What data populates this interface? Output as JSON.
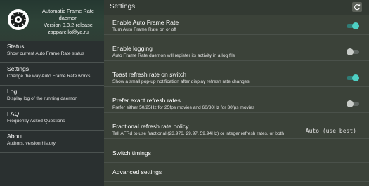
{
  "app": {
    "name_line1": "Automatic Frame Rate",
    "name_line2": "daemon",
    "version": "Version 0.3.2-release",
    "email": "zapparello@ya.ru"
  },
  "sidebar": {
    "items": [
      {
        "title": "Status",
        "desc": "Show current Auto Frame Rate status"
      },
      {
        "title": "Settings",
        "desc": "Change the way Auto Frame Rate works"
      },
      {
        "title": "Log",
        "desc": "Display log of the running daemon"
      },
      {
        "title": "FAQ",
        "desc": "Frequently Asked Questions"
      },
      {
        "title": "About",
        "desc": "Authors, version history"
      }
    ]
  },
  "header": {
    "title": "Settings",
    "refresh_icon": "refresh-icon"
  },
  "settings": {
    "enable_afr": {
      "title": "Enable Auto Frame Rate",
      "desc": "Turn Auto Frame Rate on or off",
      "on": true
    },
    "enable_logging": {
      "title": "Enable logging",
      "desc": "Auto Frame Rate daemon will register its activity in a log file",
      "on": false
    },
    "toast": {
      "title": "Toast refresh rate on switch",
      "desc": "Show a small pop-up notification after display refresh rate changes",
      "on": true
    },
    "prefer_exact": {
      "title": "Prefer exact refresh rates",
      "desc": "Prefer either 50/25Hz for 25fps movies and 60/30Hz for 30fps movies",
      "on": false
    },
    "policy": {
      "title": "Fractional refresh rate policy",
      "desc": "Tell AFRd to use fractional (23.976, 29.97, 59.94Hz) or integer refresh rates, or both",
      "value": "Auto (use best)"
    },
    "switch_timings": {
      "title": "Switch timings"
    },
    "advanced": {
      "title": "Advanced settings"
    }
  },
  "colors": {
    "accent": "#4ed0c4",
    "sidebar_bg": "#2a3030",
    "main_bg": "#3b4239"
  }
}
